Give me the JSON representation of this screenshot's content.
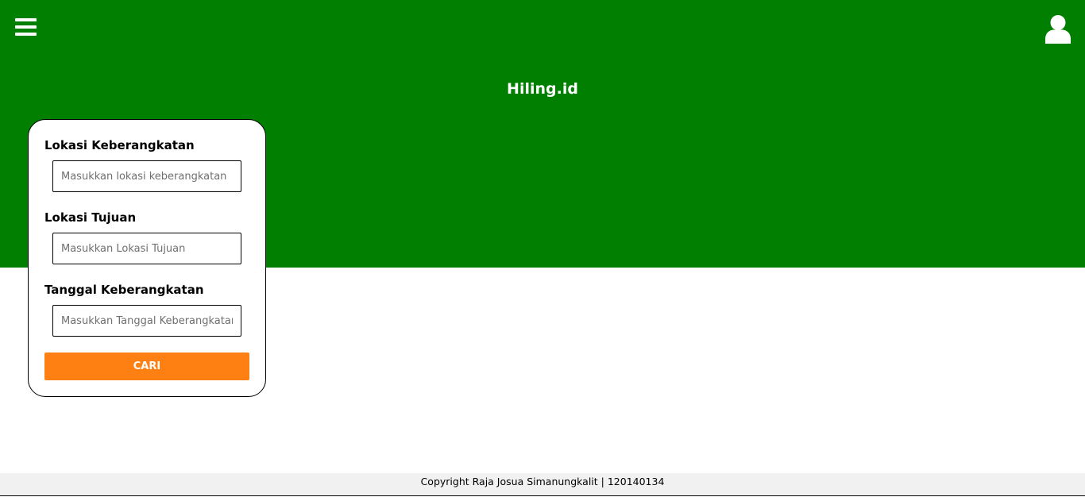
{
  "app": {
    "title": "Hiling.id"
  },
  "header": {
    "menu_icon": "hamburger-menu-icon",
    "user_icon": "user-profile-icon",
    "background_color": "#007f00"
  },
  "search_form": {
    "origin": {
      "label": "Lokasi Keberangkatan",
      "placeholder": "Masukkan lokasi keberangkatan",
      "value": ""
    },
    "destination": {
      "label": "Lokasi Tujuan",
      "placeholder": "Masukkan Lokasi Tujuan",
      "value": ""
    },
    "date": {
      "label": "Tanggal Keberangkatan",
      "placeholder": "Masukkan Tanggal Keberangkatan",
      "value": ""
    },
    "submit_label": "CARI",
    "submit_color": "#ff8012"
  },
  "footer": {
    "text": "Copyright Raja Josua Simanungkalit | 120140134"
  }
}
